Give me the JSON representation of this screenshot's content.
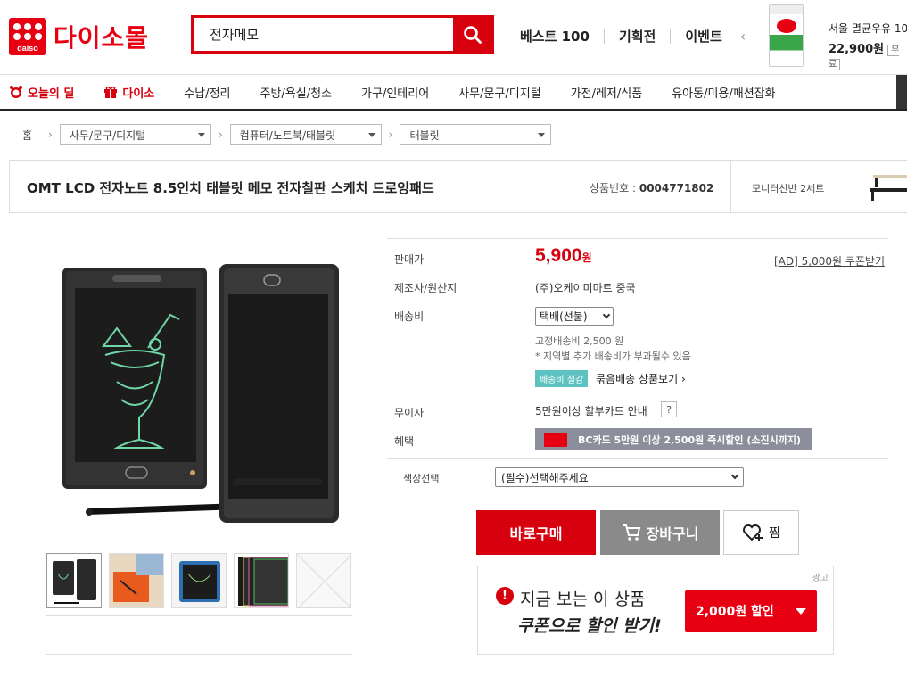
{
  "header": {
    "logo_small": "daiso",
    "logo_text": "다이소몰",
    "search_value": "전자메모",
    "nav": [
      "베스트 100",
      "기획전",
      "이벤트"
    ],
    "promo_title": "서울 멸균우유 10",
    "promo_price": "22,900원",
    "promo_badge": "무료"
  },
  "categories": [
    {
      "label": "오늘의 딜",
      "icon": "alarm-clock-icon",
      "highlight": true
    },
    {
      "label": "다이소",
      "icon": "gift-icon",
      "highlight": true
    },
    {
      "label": "수납/정리"
    },
    {
      "label": "주방/욕실/청소"
    },
    {
      "label": "가구/인테리어"
    },
    {
      "label": "사무/문구/디지털"
    },
    {
      "label": "가전/레저/식품"
    },
    {
      "label": "유아동/미용/패션잡화"
    }
  ],
  "breadcrumb": {
    "home": "홈",
    "levels": [
      "사무/문구/디지털",
      "컴퓨터/노트북/태블릿",
      "태블릿"
    ]
  },
  "product": {
    "name": "OMT LCD 전자노트 8.5인치 태블릿 메모 전자칠판 스케치 드로잉패드",
    "number_label": "상품번호 :",
    "number": "0004771802",
    "side_ad": "모니터선반 2세트"
  },
  "info": {
    "price_label": "판매가",
    "price": "5,900",
    "price_unit": "원",
    "coupon_link": "[AD] 5,000원 쿠폰받기",
    "maker_label": "제조사/원산지",
    "maker": "(주)오케이미마트 중국",
    "shipping_label": "배송비",
    "shipping_option": "택배(선불)",
    "shipping_fee": "고정배송비 2,500 원",
    "shipping_note": "* 지역별 추가 배송비가 부과될수 있음",
    "saving_tag": "배송비 절감",
    "bundle_link": "묶음배송 상품보기",
    "installment_label": "무이자",
    "installment": "5만원이상 할부카드 안내",
    "help": "?",
    "benefit_label": "혜택",
    "benefit": "BC카드 5만원 이상 2,500원 즉시할인 (소진시까지)",
    "color_label": "색상선택",
    "color_option": "(필수)선택해주세요"
  },
  "buttons": {
    "buy": "바로구매",
    "cart": "장바구니",
    "wish": "찜"
  },
  "ad": {
    "label": "광고",
    "line1": "지금 보는 이 상품",
    "line2": "쿠폰으로 할인 받기!",
    "discount": "2,000원 할인",
    "excl": "!"
  },
  "colors": {
    "brand_red": "#d7000f",
    "teal": "#5cc3c0",
    "gray_button": "#8a8a8a",
    "bc_banner": "#8c8f9b"
  }
}
